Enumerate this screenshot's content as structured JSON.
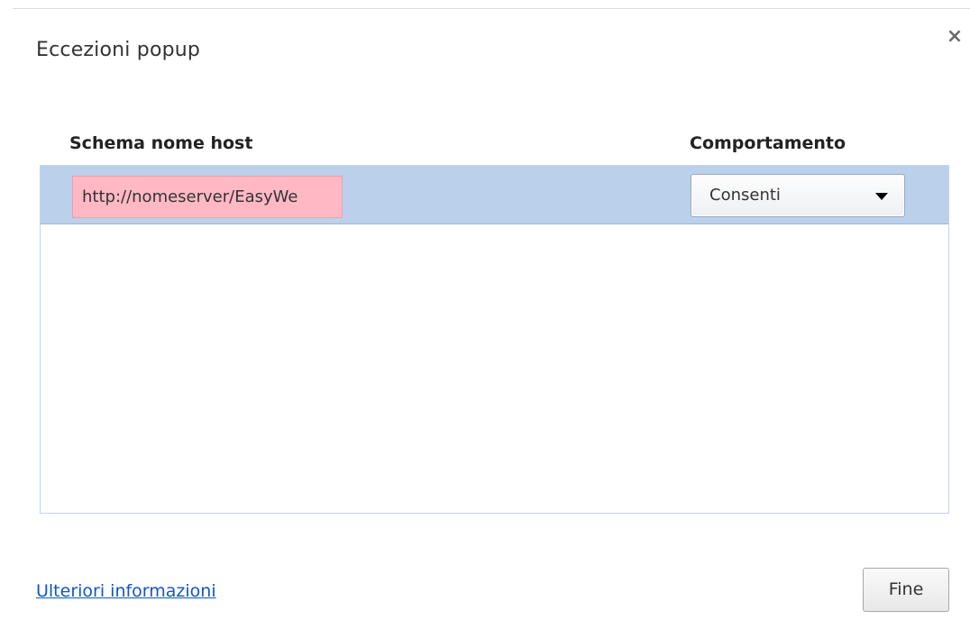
{
  "dialog": {
    "title": "Eccezioni popup",
    "close_symbol": "×"
  },
  "table": {
    "columns": [
      "Schema nome host",
      "Comportamento"
    ],
    "rows": [
      {
        "host_pattern": "http://nomeserver/EasyWe",
        "behavior": "Consenti",
        "selected": true
      }
    ]
  },
  "footer": {
    "learn_more_link": "Ulteriori informazioni",
    "done_button": "Fine"
  },
  "colors": {
    "selected_row": "#bbd0ea",
    "invalid_input": "#ffb8c4",
    "link": "#1155cc"
  }
}
